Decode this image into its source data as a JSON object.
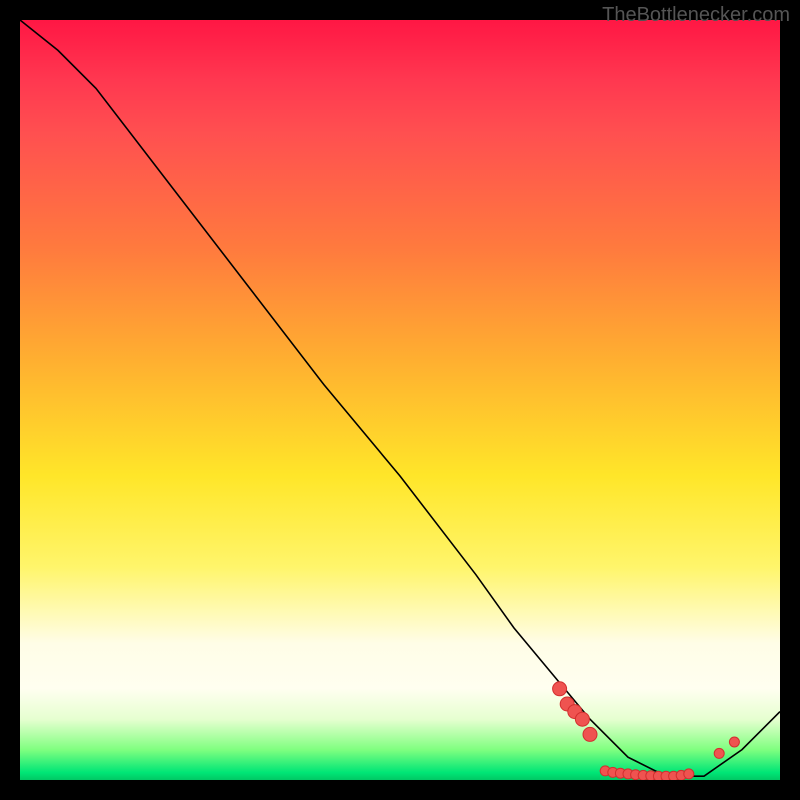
{
  "watermark": "TheBottlenecker.com",
  "chart_data": {
    "type": "line",
    "title": "",
    "xlabel": "",
    "ylabel": "",
    "xlim": [
      0,
      100
    ],
    "ylim": [
      0,
      100
    ],
    "series": [
      {
        "name": "bottleneck-curve",
        "x": [
          0,
          5,
          10,
          20,
          30,
          40,
          50,
          60,
          65,
          70,
          75,
          80,
          85,
          90,
          95,
          100
        ],
        "y": [
          100,
          96,
          91,
          78,
          65,
          52,
          40,
          27,
          20,
          14,
          8,
          3,
          0.5,
          0.5,
          4,
          9
        ]
      }
    ],
    "markers": {
      "name": "highlight-points",
      "x": [
        71,
        72,
        73,
        74,
        75,
        77,
        78,
        79,
        80,
        81,
        82,
        83,
        84,
        85,
        86,
        87,
        88,
        92,
        94
      ],
      "y": [
        12,
        10,
        9,
        8,
        6,
        1.2,
        1.0,
        0.9,
        0.8,
        0.7,
        0.6,
        0.55,
        0.5,
        0.5,
        0.5,
        0.6,
        0.8,
        3.5,
        5
      ]
    },
    "background_gradient": {
      "top": "#ff1744",
      "mid": "#ffe629",
      "bottom": "#00e676"
    }
  }
}
